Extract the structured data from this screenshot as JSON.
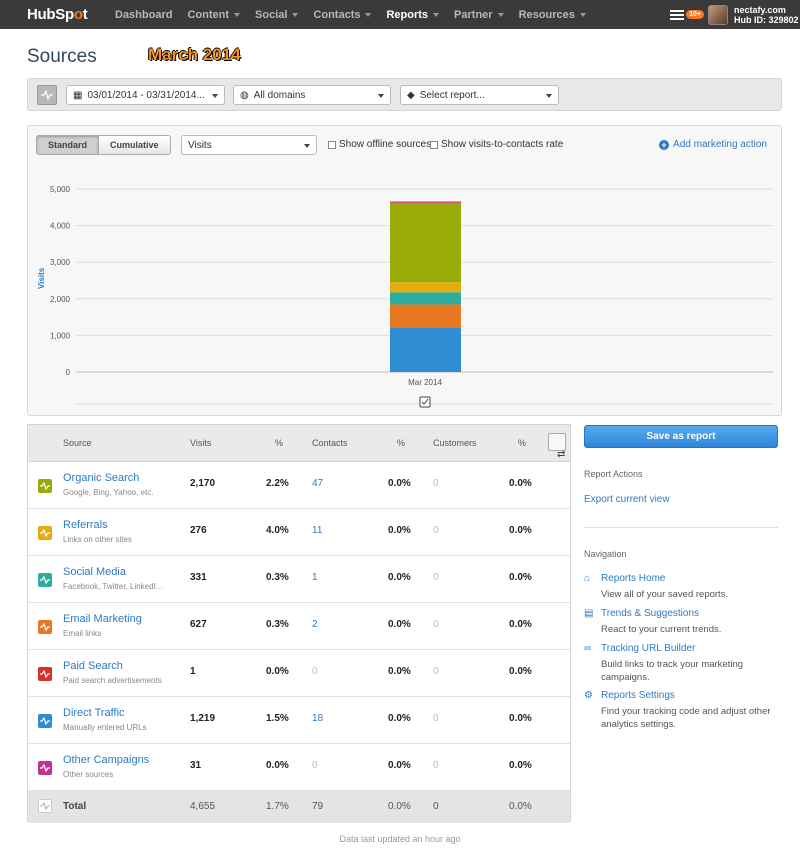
{
  "nav": {
    "logo_a": "HubSp",
    "logo_b": "o",
    "logo_c": "t",
    "items": [
      "Dashboard",
      "Content",
      "Social",
      "Contacts",
      "Reports",
      "Partner",
      "Resources"
    ],
    "notifications_badge": "10+",
    "account_name": "nectafy.com",
    "hub_id": "Hub ID: 329802"
  },
  "page": {
    "title": "Sources",
    "month_label": "March 2014"
  },
  "filters": {
    "date_range": "03/01/2014 - 03/31/2014...",
    "domains": "All domains",
    "report": "Select report..."
  },
  "chart_controls": {
    "standard": "Standard",
    "cumulative": "Cumulative",
    "metric": "Visits",
    "offline": "Show offline sources",
    "rate": "Show visits-to-contacts rate",
    "add_action": "Add marketing action"
  },
  "chart_data": {
    "type": "bar",
    "stacked": true,
    "ylabel": "Visits",
    "categories": [
      "Mar 2014"
    ],
    "ylim": [
      0,
      5000
    ],
    "yticks": [
      "0",
      "1,000",
      "2,000",
      "3,000",
      "4,000",
      "5,000"
    ],
    "series": [
      {
        "name": "Direct Traffic",
        "values": [
          1219
        ],
        "color": "#2f8dd4"
      },
      {
        "name": "Email Marketing",
        "values": [
          627
        ],
        "color": "#e87722"
      },
      {
        "name": "Social Media",
        "values": [
          331
        ],
        "color": "#2bada0"
      },
      {
        "name": "Referrals",
        "values": [
          276
        ],
        "color": "#e5ac12"
      },
      {
        "name": "Organic Search",
        "values": [
          2170
        ],
        "color": "#98ab07"
      },
      {
        "name": "Other Campaigns",
        "values": [
          31
        ],
        "color": "#c0338f"
      },
      {
        "name": "Paid Search",
        "values": [
          1
        ],
        "color": "#d9302a"
      }
    ]
  },
  "table": {
    "headers": {
      "source": "Source",
      "visits": "Visits",
      "pct": "%",
      "contacts": "Contacts",
      "cpct": "%",
      "customers": "Customers",
      "custpct": "%"
    },
    "rows": [
      {
        "name": "Organic Search",
        "sub": "Google, Bing, Yahoo, etc.",
        "visits": "2,170",
        "pct": "2.2%",
        "contacts": "47",
        "cpct": "0.0%",
        "customers": "0",
        "custpct": "0.0%",
        "color": "#98ab07"
      },
      {
        "name": "Referrals",
        "sub": "Links on other sites",
        "visits": "276",
        "pct": "4.0%",
        "contacts": "11",
        "cpct": "0.0%",
        "customers": "0",
        "custpct": "0.0%",
        "color": "#e5ac12"
      },
      {
        "name": "Social Media",
        "sub": "Facebook, Twitter, LinkedI...",
        "visits": "331",
        "pct": "0.3%",
        "contacts": "1",
        "cpct": "0.0%",
        "customers": "0",
        "custpct": "0.0%",
        "color": "#2bada0"
      },
      {
        "name": "Email Marketing",
        "sub": "Email links",
        "visits": "627",
        "pct": "0.3%",
        "contacts": "2",
        "cpct": "0.0%",
        "customers": "0",
        "custpct": "0.0%",
        "color": "#e87722"
      },
      {
        "name": "Paid Search",
        "sub": "Paid search advertisements",
        "visits": "1",
        "pct": "0.0%",
        "contacts": "0",
        "cpct": "0.0%",
        "customers": "0",
        "custpct": "0.0%",
        "color": "#d9302a"
      },
      {
        "name": "Direct Traffic",
        "sub": "Manually entered URLs",
        "visits": "1,219",
        "pct": "1.5%",
        "contacts": "18",
        "cpct": "0.0%",
        "customers": "0",
        "custpct": "0.0%",
        "color": "#2f8dd4"
      },
      {
        "name": "Other Campaigns",
        "sub": "Other sources",
        "visits": "31",
        "pct": "0.0%",
        "contacts": "0",
        "cpct": "0.0%",
        "customers": "0",
        "custpct": "0.0%",
        "color": "#c0338f"
      }
    ],
    "total": {
      "name": "Total",
      "visits": "4,655",
      "pct": "1.7%",
      "contacts": "79",
      "cpct": "0.0%",
      "customers": "0",
      "custpct": "0.0%"
    },
    "footer": "Data last updated an hour ago"
  },
  "sidebar": {
    "save": "Save as report",
    "actions_title": "Report Actions",
    "export": "Export current view",
    "nav_title": "Navigation",
    "links": [
      {
        "title": "Reports Home",
        "desc": "View all of your saved reports.",
        "icon": "home-icon"
      },
      {
        "title": "Trends & Suggestions",
        "desc": "React to your current trends.",
        "icon": "trends-icon"
      },
      {
        "title": "Tracking URL Builder",
        "desc": "Build links to track your marketing campaigns.",
        "icon": "link-icon"
      },
      {
        "title": "Reports Settings",
        "desc": "Find your tracking code and adjust other analytics settings.",
        "icon": "gear-icon"
      }
    ]
  }
}
